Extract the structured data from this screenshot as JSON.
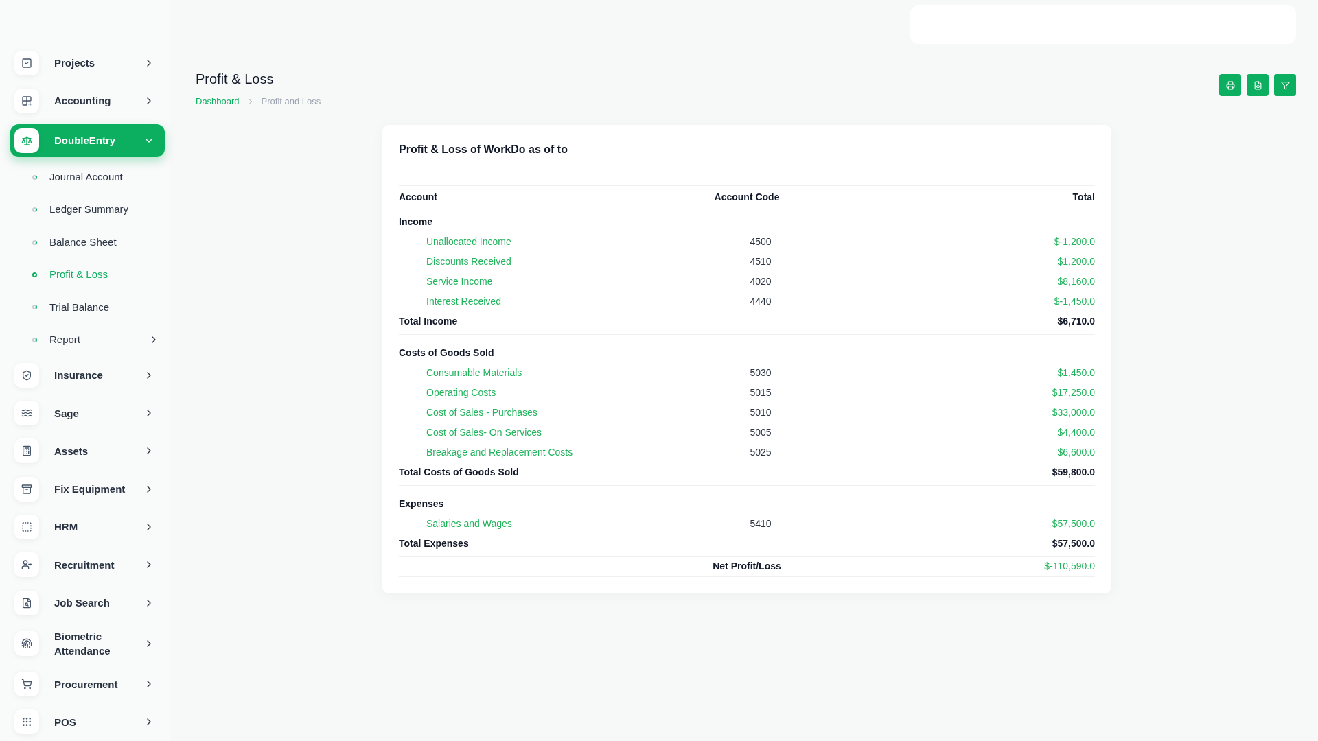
{
  "sidebar": {
    "items": [
      {
        "label": "Projects",
        "expanded": false,
        "selected": false
      },
      {
        "label": "Accounting",
        "expanded": false,
        "selected": false
      },
      {
        "label": "DoubleEntry",
        "expanded": true,
        "selected": true,
        "children": [
          {
            "label": "Journal Account",
            "kind": "link",
            "selected": false
          },
          {
            "label": "Ledger Summary",
            "kind": "link",
            "selected": false
          },
          {
            "label": "Balance Sheet",
            "kind": "link",
            "selected": false
          },
          {
            "label": "Profit & Loss",
            "kind": "link",
            "selected": true
          },
          {
            "label": "Trial Balance",
            "kind": "link",
            "selected": false
          },
          {
            "label": "Report",
            "kind": "group",
            "selected": false
          }
        ]
      },
      {
        "label": "Insurance",
        "expanded": false,
        "selected": false
      },
      {
        "label": "Sage",
        "expanded": false,
        "selected": false
      },
      {
        "label": "Assets",
        "expanded": false,
        "selected": false
      },
      {
        "label": "Fix Equipment",
        "expanded": false,
        "selected": false
      },
      {
        "label": "HRM",
        "expanded": false,
        "selected": false
      },
      {
        "label": "Recruitment",
        "expanded": false,
        "selected": false
      },
      {
        "label": "Job Search",
        "expanded": false,
        "selected": false
      },
      {
        "label": "Biometric Attendance",
        "expanded": false,
        "selected": false
      },
      {
        "label": "Procurement",
        "expanded": false,
        "selected": false
      },
      {
        "label": "POS",
        "expanded": false,
        "selected": false
      }
    ]
  },
  "page": {
    "title": "Profit & Loss",
    "breadcrumb": [
      "Dashboard",
      "Profit and Loss"
    ]
  },
  "card": {
    "title": "Profit & Loss of WorkDo as of to",
    "table": {
      "columns": [
        "Account",
        "Account Code",
        "Total"
      ],
      "sections": [
        {
          "title": "Income",
          "rows": [
            {
              "account": "Unallocated Income",
              "code": "4500",
              "total": "$-1,200.0"
            },
            {
              "account": "Discounts Received",
              "code": "4510",
              "total": "$1,200.0"
            },
            {
              "account": "Service Income",
              "code": "4020",
              "total": "$8,160.0"
            },
            {
              "account": "Interest Received",
              "code": "4440",
              "total": "$-1,450.0"
            }
          ],
          "total": {
            "label": "Total Income",
            "value": "$6,710.0"
          }
        },
        {
          "title": "Costs of Goods Sold",
          "rows": [
            {
              "account": "Consumable Materials",
              "code": "5030",
              "total": "$1,450.0"
            },
            {
              "account": "Operating Costs",
              "code": "5015",
              "total": "$17,250.0"
            },
            {
              "account": "Cost of Sales - Purchases",
              "code": "5010",
              "total": "$33,000.0"
            },
            {
              "account": "Cost of Sales- On Services",
              "code": "5005",
              "total": "$4,400.0"
            },
            {
              "account": "Breakage and Replacement Costs",
              "code": "5025",
              "total": "$6,600.0"
            }
          ],
          "total": {
            "label": "Total Costs of Goods Sold",
            "value": "$59,800.0"
          }
        },
        {
          "title": "Expenses",
          "rows": [
            {
              "account": "Salaries and Wages",
              "code": "5410",
              "total": "$57,500.0"
            }
          ],
          "total": {
            "label": "Total Expenses",
            "value": "$57,500.0"
          }
        }
      ],
      "net": {
        "label": "Net Profit/Loss",
        "value": "$-110,590.0"
      }
    }
  }
}
